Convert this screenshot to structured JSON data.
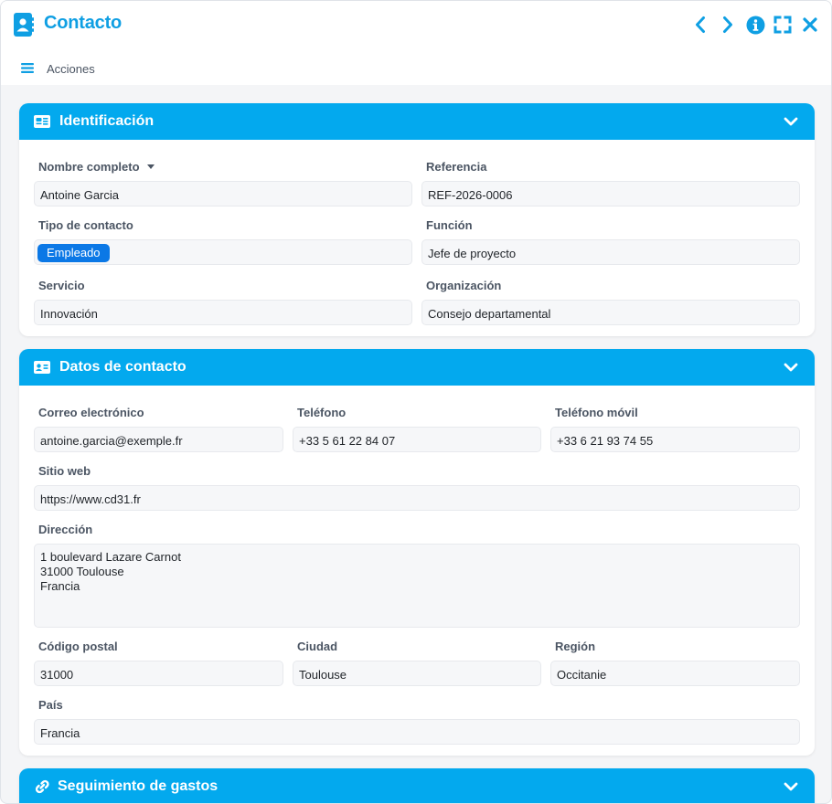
{
  "window": {
    "title": "Contacto",
    "accent": "#03a9ee",
    "icons": [
      "address-book-icon",
      "chevron-left-icon",
      "chevron-right-icon",
      "info-icon",
      "expand-icon",
      "close-icon"
    ]
  },
  "actionbar": {
    "menu_icon": "hamburger-icon",
    "label": "Acciones"
  },
  "identificacion": {
    "title": "Identificación",
    "icon": "id-card-icon",
    "nombre": {
      "label": "Nombre completo",
      "value": "Antoine Garcia"
    },
    "referencia": {
      "label": "Referencia",
      "value": "REF-2026-0006"
    },
    "tipo": {
      "label": "Tipo de contacto",
      "tag": "Empleado",
      "tag_color": "#0b78e6"
    },
    "funcion": {
      "label": "Función",
      "value": "Jefe de proyecto"
    },
    "servicio": {
      "label": "Servicio",
      "value": "Innovación"
    },
    "organizacion": {
      "label": "Organización",
      "value": "Consejo departamental"
    }
  },
  "datos": {
    "title": "Datos de contacto",
    "icon": "contact-card-icon",
    "correo": {
      "label": "Correo electrónico",
      "value": "antoine.garcia@exemple.fr"
    },
    "telefono": {
      "label": "Teléfono",
      "value": "+33 5 61 22 84 07"
    },
    "movil": {
      "label": "Teléfono móvil",
      "value": "+33 6 21 93 74 55"
    },
    "web": {
      "label": "Sitio web",
      "value": "https://www.cd31.fr"
    },
    "direccion": {
      "label": "Dirección",
      "value": "1 boulevard Lazare Carnot\n31000 Toulouse\nFrancia"
    },
    "cp": {
      "label": "Código postal",
      "value": "31000"
    },
    "ciudad": {
      "label": "Ciudad",
      "value": "Toulouse"
    },
    "region": {
      "label": "Región",
      "value": "Occitanie"
    },
    "pais": {
      "label": "País",
      "value": "Francia"
    }
  },
  "gastos": {
    "title": "Seguimiento de gastos",
    "icon": "link-icon"
  }
}
